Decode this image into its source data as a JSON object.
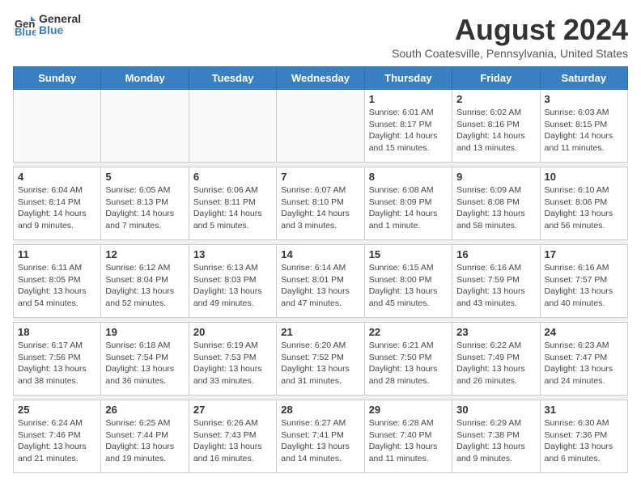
{
  "logo": {
    "general": "General",
    "blue": "Blue"
  },
  "title": "August 2024",
  "subtitle": "South Coatesville, Pennsylvania, United States",
  "headers": [
    "Sunday",
    "Monday",
    "Tuesday",
    "Wednesday",
    "Thursday",
    "Friday",
    "Saturday"
  ],
  "weeks": [
    [
      {
        "date": "",
        "text": ""
      },
      {
        "date": "",
        "text": ""
      },
      {
        "date": "",
        "text": ""
      },
      {
        "date": "",
        "text": ""
      },
      {
        "date": "1",
        "text": "Sunrise: 6:01 AM\nSunset: 8:17 PM\nDaylight: 14 hours\nand 15 minutes."
      },
      {
        "date": "2",
        "text": "Sunrise: 6:02 AM\nSunset: 8:16 PM\nDaylight: 14 hours\nand 13 minutes."
      },
      {
        "date": "3",
        "text": "Sunrise: 6:03 AM\nSunset: 8:15 PM\nDaylight: 14 hours\nand 11 minutes."
      }
    ],
    [
      {
        "date": "4",
        "text": "Sunrise: 6:04 AM\nSunset: 8:14 PM\nDaylight: 14 hours\nand 9 minutes."
      },
      {
        "date": "5",
        "text": "Sunrise: 6:05 AM\nSunset: 8:13 PM\nDaylight: 14 hours\nand 7 minutes."
      },
      {
        "date": "6",
        "text": "Sunrise: 6:06 AM\nSunset: 8:11 PM\nDaylight: 14 hours\nand 5 minutes."
      },
      {
        "date": "7",
        "text": "Sunrise: 6:07 AM\nSunset: 8:10 PM\nDaylight: 14 hours\nand 3 minutes."
      },
      {
        "date": "8",
        "text": "Sunrise: 6:08 AM\nSunset: 8:09 PM\nDaylight: 14 hours\nand 1 minute."
      },
      {
        "date": "9",
        "text": "Sunrise: 6:09 AM\nSunset: 8:08 PM\nDaylight: 13 hours\nand 58 minutes."
      },
      {
        "date": "10",
        "text": "Sunrise: 6:10 AM\nSunset: 8:06 PM\nDaylight: 13 hours\nand 56 minutes."
      }
    ],
    [
      {
        "date": "11",
        "text": "Sunrise: 6:11 AM\nSunset: 8:05 PM\nDaylight: 13 hours\nand 54 minutes."
      },
      {
        "date": "12",
        "text": "Sunrise: 6:12 AM\nSunset: 8:04 PM\nDaylight: 13 hours\nand 52 minutes."
      },
      {
        "date": "13",
        "text": "Sunrise: 6:13 AM\nSunset: 8:03 PM\nDaylight: 13 hours\nand 49 minutes."
      },
      {
        "date": "14",
        "text": "Sunrise: 6:14 AM\nSunset: 8:01 PM\nDaylight: 13 hours\nand 47 minutes."
      },
      {
        "date": "15",
        "text": "Sunrise: 6:15 AM\nSunset: 8:00 PM\nDaylight: 13 hours\nand 45 minutes."
      },
      {
        "date": "16",
        "text": "Sunrise: 6:16 AM\nSunset: 7:59 PM\nDaylight: 13 hours\nand 43 minutes."
      },
      {
        "date": "17",
        "text": "Sunrise: 6:16 AM\nSunset: 7:57 PM\nDaylight: 13 hours\nand 40 minutes."
      }
    ],
    [
      {
        "date": "18",
        "text": "Sunrise: 6:17 AM\nSunset: 7:56 PM\nDaylight: 13 hours\nand 38 minutes."
      },
      {
        "date": "19",
        "text": "Sunrise: 6:18 AM\nSunset: 7:54 PM\nDaylight: 13 hours\nand 36 minutes."
      },
      {
        "date": "20",
        "text": "Sunrise: 6:19 AM\nSunset: 7:53 PM\nDaylight: 13 hours\nand 33 minutes."
      },
      {
        "date": "21",
        "text": "Sunrise: 6:20 AM\nSunset: 7:52 PM\nDaylight: 13 hours\nand 31 minutes."
      },
      {
        "date": "22",
        "text": "Sunrise: 6:21 AM\nSunset: 7:50 PM\nDaylight: 13 hours\nand 28 minutes."
      },
      {
        "date": "23",
        "text": "Sunrise: 6:22 AM\nSunset: 7:49 PM\nDaylight: 13 hours\nand 26 minutes."
      },
      {
        "date": "24",
        "text": "Sunrise: 6:23 AM\nSunset: 7:47 PM\nDaylight: 13 hours\nand 24 minutes."
      }
    ],
    [
      {
        "date": "25",
        "text": "Sunrise: 6:24 AM\nSunset: 7:46 PM\nDaylight: 13 hours\nand 21 minutes."
      },
      {
        "date": "26",
        "text": "Sunrise: 6:25 AM\nSunset: 7:44 PM\nDaylight: 13 hours\nand 19 minutes."
      },
      {
        "date": "27",
        "text": "Sunrise: 6:26 AM\nSunset: 7:43 PM\nDaylight: 13 hours\nand 16 minutes."
      },
      {
        "date": "28",
        "text": "Sunrise: 6:27 AM\nSunset: 7:41 PM\nDaylight: 13 hours\nand 14 minutes."
      },
      {
        "date": "29",
        "text": "Sunrise: 6:28 AM\nSunset: 7:40 PM\nDaylight: 13 hours\nand 11 minutes."
      },
      {
        "date": "30",
        "text": "Sunrise: 6:29 AM\nSunset: 7:38 PM\nDaylight: 13 hours\nand 9 minutes."
      },
      {
        "date": "31",
        "text": "Sunrise: 6:30 AM\nSunset: 7:36 PM\nDaylight: 13 hours\nand 6 minutes."
      }
    ]
  ]
}
